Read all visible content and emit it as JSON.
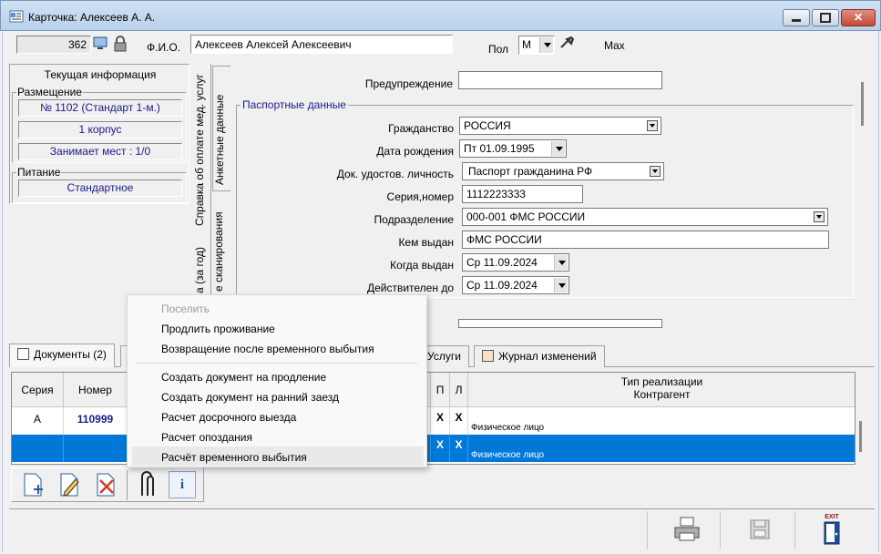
{
  "window": {
    "title": "Карточка: Алексеев А. А.",
    "close_glyph": "✕"
  },
  "header": {
    "record_id": "362",
    "fio_label": "Ф.И.О.",
    "fio_value": "Алексеев Алексей Алексеевич",
    "pol_label": "Пол",
    "pol_value": "М",
    "max_label": "Max"
  },
  "left_panel": {
    "title": "Текущая информация",
    "placement_label": "Размещение",
    "room": "№ 1102 (Стандарт 1-м.)",
    "building": "1 корпус",
    "places": "Занимает мест : 1/0",
    "food_label": "Питание",
    "food_value": "Стандартное"
  },
  "vertical_tabs": {
    "tab1": "Анкетные данные",
    "tab2": "Справка об оплате мед. услуг",
    "tab3": "е сканирования",
    "tab4": "а (за год)"
  },
  "form": {
    "warning_label": "Предупреждение",
    "warning_value": "",
    "passport_group": "Паспортные данные",
    "citizenship_label": "Гражданство",
    "citizenship_value": "РОССИЯ",
    "birthdate_label": "Дата рождения",
    "birthdate_value": "Пт  01.09.1995",
    "doc_label": "Док. удостов. личность",
    "doc_value": "Паспорт гражданина РФ",
    "serial_label": "Серия,номер",
    "serial_value": "1112223333",
    "division_label": "Подразделение",
    "division_value": "000-001 ФМС РОССИИ",
    "issued_by_label": "Кем выдан",
    "issued_by_value": "ФМС РОССИИ",
    "issued_date_label": "Когда выдан",
    "issued_date_value": "Ср  11.09.2024",
    "valid_until_label": "Действителен до",
    "valid_until_value": "Ср  11.09.2024"
  },
  "bottom_tabs": {
    "documents": "Документы (2)",
    "services": "Услуги",
    "changelog": "Журнал изменений"
  },
  "grid": {
    "col_series": "Серия",
    "col_number": "Номер",
    "col_p": "П",
    "col_l": "Л",
    "col_type_1": "Тип реализации",
    "col_type_2": "Контрагент",
    "rows": [
      {
        "series": "А",
        "number": "110999",
        "p": "X",
        "l": "X",
        "contractor": "Физическое лицо"
      },
      {
        "series": "",
        "number": "",
        "p": "X",
        "l": "X",
        "contractor": "Физическое лицо"
      }
    ]
  },
  "toolbar": {
    "info_glyph": "i"
  },
  "status": {
    "exit_label": "EXIT"
  },
  "context_menu": {
    "settle": "Поселить",
    "extend": "Продлить проживание",
    "return": "Возвращение после временного выбытия",
    "create_extension": "Создать документ на продление",
    "create_early": "Создать документ на ранний заезд",
    "early_departure": "Расчет досрочного выезда",
    "lateness": "Расчет опоздания",
    "temp_leave": "Расчёт временного выбытия"
  }
}
